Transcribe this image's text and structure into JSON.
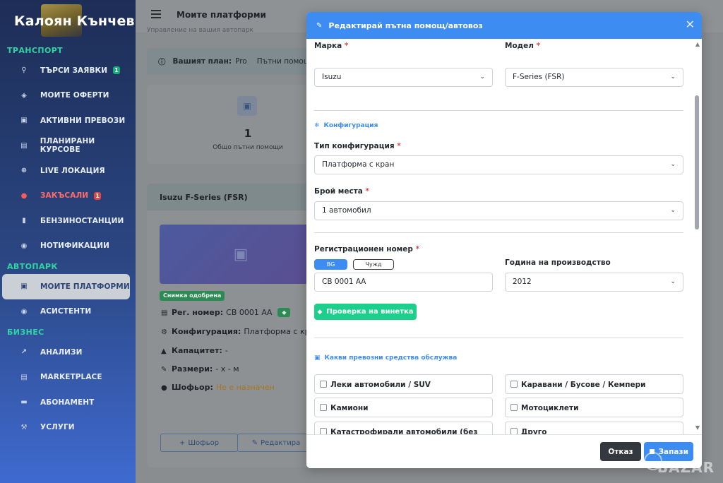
{
  "brand": {
    "name": "Калоян Кънчев"
  },
  "sidebar": {
    "sections": [
      {
        "title": "ТРАНСПОРТ"
      },
      {
        "title": "АВТОПАРК"
      },
      {
        "title": "БИЗНЕС"
      }
    ],
    "items": [
      {
        "label": "ТЪРСИ ЗАЯВКИ",
        "icon": "search-icon",
        "badge": "1"
      },
      {
        "label": "МОИТЕ ОФЕРТИ",
        "icon": "tag-icon"
      },
      {
        "label": "АКТИВНИ ПРЕВОЗИ",
        "icon": "truck-icon"
      },
      {
        "label": "ПЛАНИРАНИ КУРСОВЕ",
        "icon": "calendar-icon"
      },
      {
        "label": "LIVE ЛОКАЦИЯ",
        "icon": "crosshair-icon"
      },
      {
        "label": "ЗАКЪСАЛИ",
        "icon": "alert-icon",
        "badge": "1"
      },
      {
        "label": "БЕНЗИНОСТАНЦИИ",
        "icon": "fuel-icon"
      },
      {
        "label": "НОТИФИКАЦИИ",
        "icon": "bell-icon"
      },
      {
        "label": "МОИТЕ ПЛАТФОРМИ",
        "icon": "truck-icon"
      },
      {
        "label": "АСИСТЕНТИ",
        "icon": "users-icon"
      },
      {
        "label": "АНАЛИЗИ",
        "icon": "chart-icon"
      },
      {
        "label": "MARKETPLACE",
        "icon": "store-icon"
      },
      {
        "label": "АБОНАМЕНТ",
        "icon": "card-icon"
      },
      {
        "label": "УСЛУГИ",
        "icon": "tools-icon"
      }
    ]
  },
  "header": {
    "title": "Моите платформи",
    "subtitle": "Управление на вашия автопарк"
  },
  "plan": {
    "label": "Вашият план:",
    "name": "Pro",
    "extra": "Пътни помощ..."
  },
  "stats": {
    "count": "1",
    "label": "Общо пътни помощи"
  },
  "platform_card": {
    "title": "Isuzu F-Series (FSR)",
    "approved": "Снимка одобрена",
    "reg_label": "Рег. номер:",
    "reg_value": "СВ 0001 АА",
    "config_label": "Конфигурация:",
    "config_value": "Платформа с кр",
    "capacity_label": "Капацитет:",
    "capacity_value": "-",
    "size_label": "Размери:",
    "size_value": "- x - м",
    "driver_label": "Шофьор:",
    "driver_value": "Не е назначен",
    "btn_driver": "Шофьор",
    "btn_edit": "Редактира"
  },
  "modal": {
    "title": "Редактирай пътна помощ/автовоз",
    "brand_label": "Марка",
    "brand_value": "Isuzu",
    "model_label": "Модел",
    "model_value": "F-Series (FSR)",
    "config_section": "Конфигурация",
    "config_type_label": "Тип конфигурация",
    "config_type_value": "Платформа с кран",
    "seats_label": "Брой места",
    "seats_value": "1 автомобил",
    "reg_label": "Регистрационен номер",
    "reg_toggle_bg": "BG",
    "reg_toggle_foreign": "Чужд",
    "reg_value": "СВ 0001 АА",
    "year_label": "Година на производство",
    "year_value": "2012",
    "vignette_button": "Проверка на винетка",
    "vehicles_section": "Какви превозни средства обслужва",
    "vehicle_types": [
      "Леки автомобили / SUV",
      "Каравани / Бусове / Кемпери",
      "Камиони",
      "Мотоциклети",
      "Катастрофирали автомобили (без колела)",
      "Друго"
    ],
    "cancel": "Отказ",
    "save": "Запази"
  },
  "watermark": "BAZAR",
  "colors": {
    "accent": "#3d8cf1",
    "success": "#1dcf8c",
    "sidebar_section": "#2fd5a0",
    "danger": "#e5484d"
  }
}
